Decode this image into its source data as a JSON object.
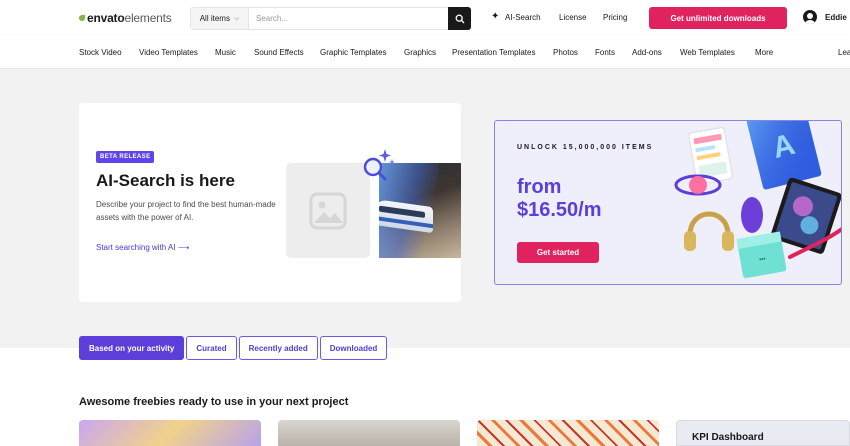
{
  "header": {
    "logo_envato": "envato",
    "logo_elements": "elements",
    "search_category": "All items",
    "search_placeholder": "Search...",
    "ai_search_label": "AI-Search",
    "license_label": "License",
    "pricing_label": "Pricing",
    "cta_label": "Get unlimited downloads",
    "user_name": "Eddie"
  },
  "nav": {
    "items": [
      "Stock Video",
      "Video Templates",
      "Music",
      "Sound Effects",
      "Graphic Templates",
      "Graphics",
      "Presentation Templates",
      "Photos",
      "Fonts",
      "Add-ons",
      "Web Templates",
      "More",
      "Lea"
    ]
  },
  "ai_card": {
    "badge": "BETA RELEASE",
    "title": "AI-Search is here",
    "description": "Describe your project to find the best human-made assets with the power of AI.",
    "link_label": "Start searching with AI ⟶"
  },
  "promo": {
    "eyebrow": "UNLOCK 15,000,000 ITEMS",
    "price_line1": "from",
    "price_line2": "$16.50/m",
    "button_label": "Get started"
  },
  "tabs": [
    {
      "label": "Based on your activity",
      "active": true
    },
    {
      "label": "Curated",
      "active": false
    },
    {
      "label": "Recently added",
      "active": false
    },
    {
      "label": "Downloaded",
      "active": false
    }
  ],
  "section": {
    "title": "Awesome freebies ready to use in your next project",
    "kpi_card_title": "KPI Dashboard"
  },
  "colors": {
    "brand_pink": "#e0235f",
    "accent_purple": "#5b3fd8",
    "envato_green": "#82b541"
  }
}
